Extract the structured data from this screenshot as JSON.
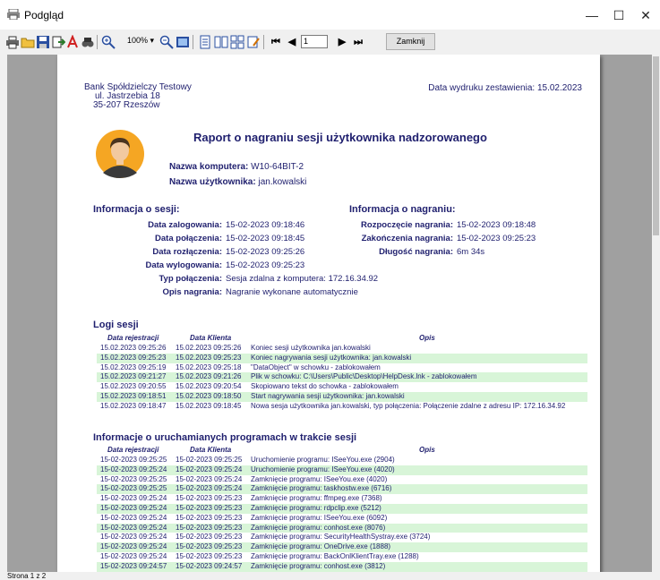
{
  "window": {
    "title": "Podgląd",
    "minimize": "—",
    "maximize": "☐",
    "close": "✕"
  },
  "toolbar": {
    "zoom": "100%",
    "page": "1",
    "close_label": "Zamknij"
  },
  "status": {
    "text": "Strona 1 z 2"
  },
  "report": {
    "bank": {
      "name": "Bank Spółdzielczy Testowy",
      "street": "ul. Jastrzebia 18",
      "city": "35-207 Rzeszów"
    },
    "print_date": "Data wydruku zestawienia: 15.02.2023",
    "title": "Raport o nagraniu sesji użytkownika nadzorowanego",
    "computer": {
      "label": "Nazwa komputera:",
      "value": "W10-64BIT-2"
    },
    "username": {
      "label": "Nazwa użytkownika:",
      "value": "jan.kowalski"
    },
    "session_header": "Informacja o sesji:",
    "recording_header": "Informacja o nagraniu:",
    "session": [
      {
        "label": "Data zalogowania:",
        "value": "15-02-2023 09:18:46"
      },
      {
        "label": "Data połączenia:",
        "value": "15-02-2023 09:18:45"
      },
      {
        "label": "Data rozłączenia:",
        "value": "15-02-2023 09:25:26"
      },
      {
        "label": "Data wylogowania:",
        "value": "15-02-2023 09:25:23"
      },
      {
        "label": "Typ połączenia:",
        "value": "Sesja zdalna z komputera: 172.16.34.92"
      },
      {
        "label": "Opis nagrania:",
        "value": "Nagranie wykonane automatycznie"
      }
    ],
    "recording": [
      {
        "label": "Rozpoczęcie nagrania:",
        "value": "15-02-2023 09:18:48"
      },
      {
        "label": "Zakończenia nagrania:",
        "value": "15-02-2023 09:25:23"
      },
      {
        "label": "Długość nagrania:",
        "value": "6m 34s"
      }
    ],
    "logs_header": "Logi sesji",
    "logs_cols": [
      "Data rejestracji",
      "Data Klienta",
      "Opis"
    ],
    "logs": [
      [
        "15.02.2023 09:25:26",
        "15.02.2023 09:25:26",
        "Koniec sesji użytkownika jan.kowalski"
      ],
      [
        "15.02.2023 09:25:23",
        "15.02.2023 09:25:23",
        "Koniec nagrywania sesji użytkownika: jan.kowalski"
      ],
      [
        "15.02.2023 09:25:19",
        "15.02.2023 09:25:18",
        "\"DataObject\" w schowku - zablokowałem"
      ],
      [
        "15.02.2023 09:21:27",
        "15.02.2023 09:21:26",
        "Plik w schowku: C:\\Users\\Public\\Desktop\\HelpDesk.lnk - zablokowałem"
      ],
      [
        "15.02.2023 09:20:55",
        "15.02.2023 09:20:54",
        "Skopiowano tekst do schowka - zablokowałem"
      ],
      [
        "15.02.2023 09:18:51",
        "15.02.2023 09:18:50",
        "Start nagrywania sesji użytkownika: jan.kowalski"
      ],
      [
        "15.02.2023 09:18:47",
        "15.02.2023 09:18:45",
        "Nowa sesja użytkownika jan.kowalski, typ połączenia: Połączenie zdalne z adresu IP: 172.16.34.92"
      ]
    ],
    "apps_header": "Informacje o uruchamianych programach w trakcie sesji",
    "apps_cols": [
      "Data rejestracji",
      "Data Klienta",
      "Opis"
    ],
    "apps": [
      [
        "15-02-2023 09:25:25",
        "15-02-2023 09:25:25",
        "Uruchomienie programu: ISeeYou.exe (2904)"
      ],
      [
        "15-02-2023 09:25:24",
        "15-02-2023 09:25:24",
        "Uruchomienie programu: ISeeYou.exe (4020)"
      ],
      [
        "15-02-2023 09:25:25",
        "15-02-2023 09:25:24",
        "Zamknięcie programu: ISeeYou.exe (4020)"
      ],
      [
        "15-02-2023 09:25:25",
        "15-02-2023 09:25:24",
        "Zamknięcie programu: taskhostw.exe (6716)"
      ],
      [
        "15-02-2023 09:25:24",
        "15-02-2023 09:25:23",
        "Zamknięcie programu: ffmpeg.exe (7368)"
      ],
      [
        "15-02-2023 09:25:24",
        "15-02-2023 09:25:23",
        "Zamknięcie programu: rdpclip.exe (5212)"
      ],
      [
        "15-02-2023 09:25:24",
        "15-02-2023 09:25:23",
        "Zamknięcie programu: ISeeYou.exe (6092)"
      ],
      [
        "15-02-2023 09:25:24",
        "15-02-2023 09:25:23",
        "Zamknięcie programu: conhost.exe (8076)"
      ],
      [
        "15-02-2023 09:25:24",
        "15-02-2023 09:25:23",
        "Zamknięcie programu: SecurityHealthSystray.exe (3724)"
      ],
      [
        "15-02-2023 09:25:24",
        "15-02-2023 09:25:23",
        "Zamknięcie programu: OneDrive.exe (1888)"
      ],
      [
        "15-02-2023 09:25:24",
        "15-02-2023 09:25:23",
        "Zamknięcie programu: BackOnlKlientTray.exe (1288)"
      ],
      [
        "15-02-2023 09:24:57",
        "15-02-2023 09:24:57",
        "Zamknięcie programu: conhost.exe (3812)"
      ]
    ]
  }
}
